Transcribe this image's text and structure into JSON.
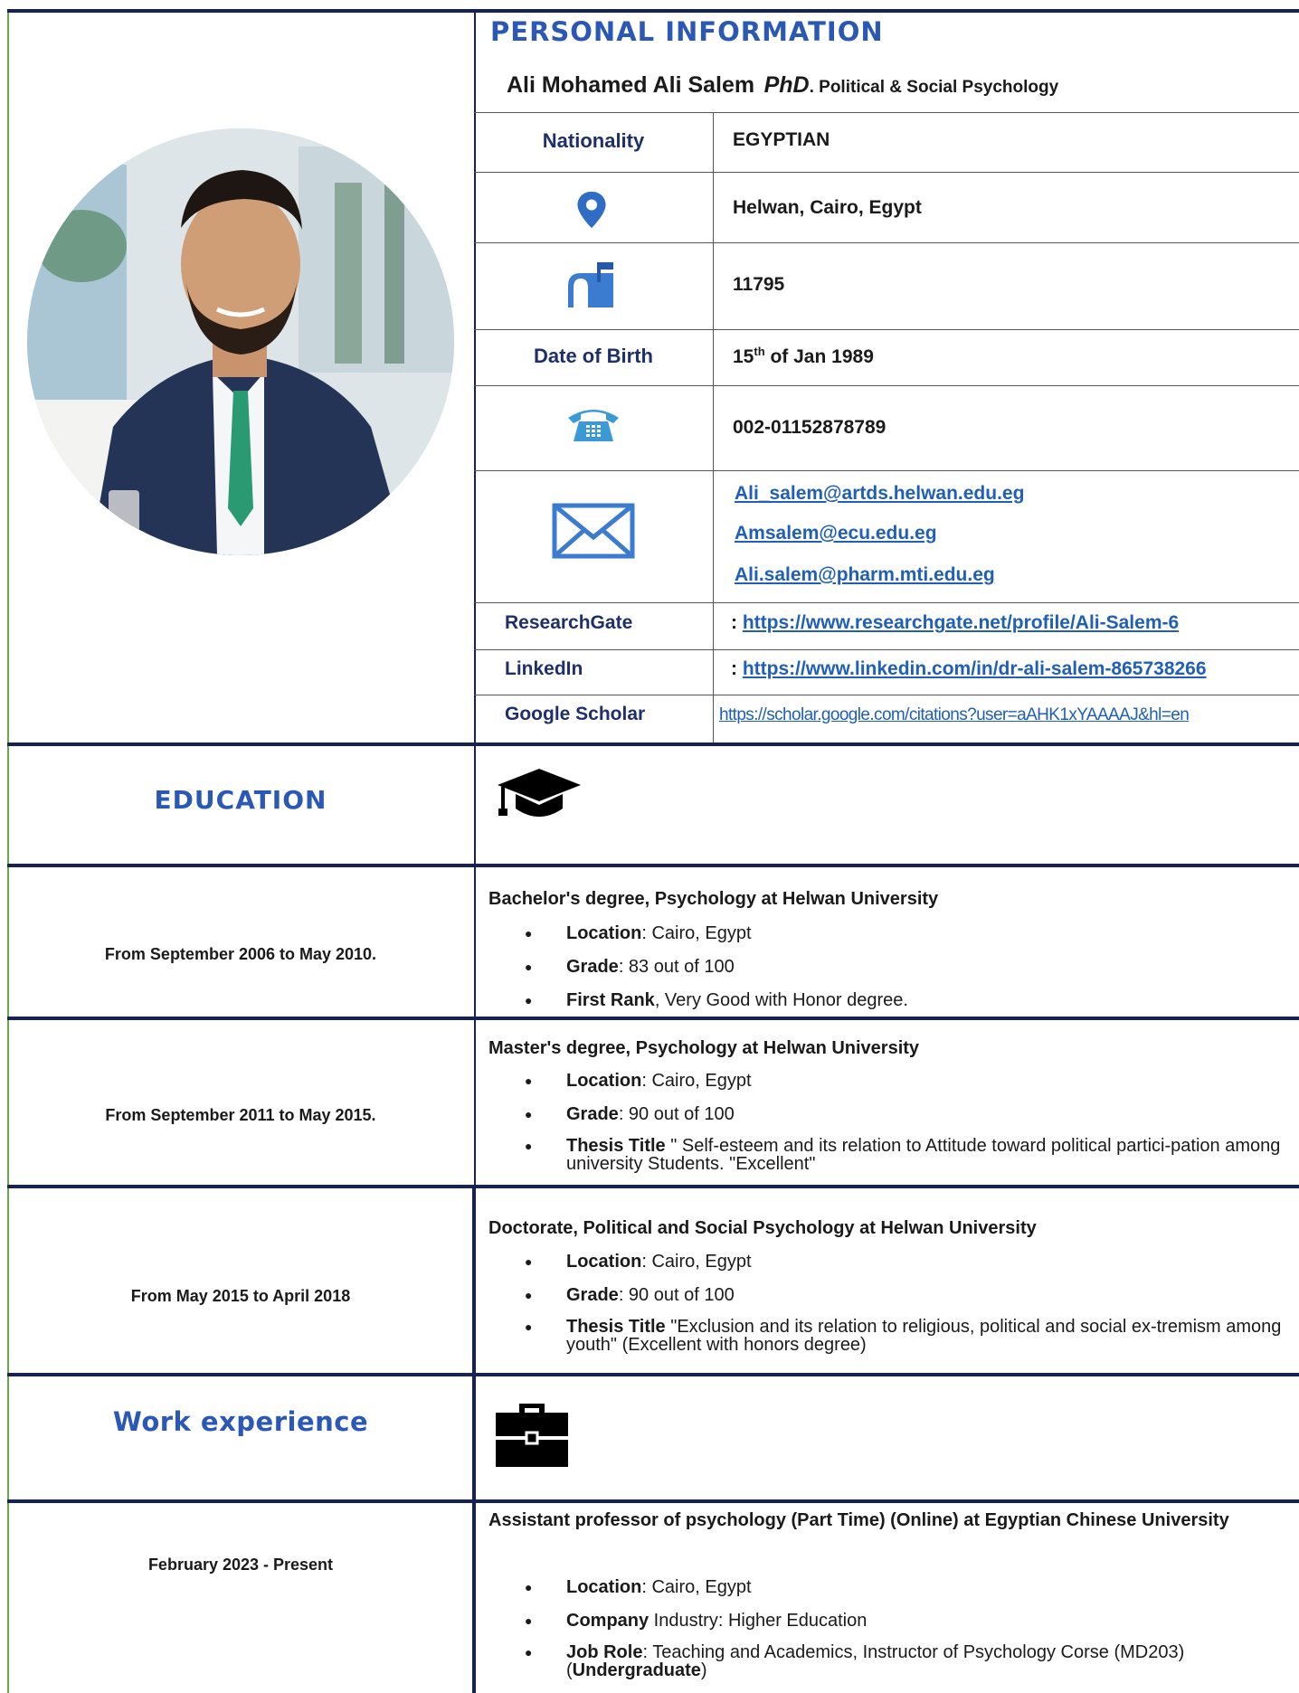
{
  "personal": {
    "section_title": "PERSONAL INFORMATION",
    "name": "Ali Mohamed Ali Salem",
    "degree": "PhD",
    "field": ". Political & Social Psychology",
    "nationality_label": "Nationality",
    "nationality": "EGYPTIAN",
    "address": "Helwan, Cairo, Egypt",
    "postal_code": "11795",
    "dob_label": "Date of Birth",
    "dob_day": "15",
    "dob_sup": "th",
    "dob_rest": " of Jan 1989",
    "phone": "002-01152878789",
    "emails": [
      "Ali_salem@artds.helwan.edu.eg",
      "Amsalem@ecu.edu.eg",
      "Ali.salem@pharm.mti.edu.eg"
    ],
    "researchgate_label": "ResearchGate",
    "researchgate_prefix": ": ",
    "researchgate_url": "https://www.researchgate.net/profile/Ali-Salem-6",
    "linkedin_label": "LinkedIn",
    "linkedin_prefix": ": ",
    "linkedin_url": "https://www.linkedin.com/in/dr-ali-salem-865738266",
    "scholar_label": "Google Scholar",
    "scholar_url": "https://scholar.google.com/citations?user=aAHK1xYAAAAJ&hl=en"
  },
  "icons": {
    "location": "map-pin-icon",
    "mailbox": "mailbox-icon",
    "phone": "telephone-icon",
    "email": "envelope-icon",
    "education": "graduation-cap-icon",
    "work": "briefcase-icon"
  },
  "colors": {
    "accent": "#2b58b4",
    "navy": "#17234e",
    "link": "#1f5fb8",
    "icon": "#3b7bd0"
  },
  "education": {
    "section_title": "EDUCATION",
    "entries": [
      {
        "date": "From September 2006 to May 2010.",
        "title": "Bachelor's degree, Psychology at Helwan University",
        "bullets": [
          {
            "bold": "Location",
            "text": ": Cairo, Egypt"
          },
          {
            "bold": "Grade",
            "text": ": 83 out of 100"
          },
          {
            "bold": "First Rank",
            "text": ", Very Good with Honor degree."
          }
        ]
      },
      {
        "date": "From September 2011 to May 2015.",
        "title": "Master's degree, Psychology at Helwan University",
        "bullets": [
          {
            "bold": "Location",
            "text": ": Cairo, Egypt"
          },
          {
            "bold": "Grade",
            "text": ": 90 out of 100"
          },
          {
            "bold": "Thesis Title",
            "text": " \" Self-esteem and its relation to Attitude toward political partici-pation among university Students. \"Excellent\""
          }
        ]
      },
      {
        "date": "From May 2015 to April 2018",
        "title": "Doctorate, Political and Social Psychology at Helwan University",
        "bullets": [
          {
            "bold": "Location",
            "text": ": Cairo, Egypt"
          },
          {
            "bold": "Grade",
            "text": ": 90 out of 100"
          },
          {
            "bold": "Thesis Title",
            "text": " \"Exclusion and its relation to religious, political and social ex-tremism among youth\" (Excellent with honors degree)"
          }
        ]
      }
    ]
  },
  "work": {
    "section_title": "Work experience",
    "entries": [
      {
        "date": "February 2023 - Present",
        "title": "Assistant professor of psychology (Part Time) (Online) at Egyptian Chinese University",
        "bullets": [
          {
            "bold": "Location",
            "text": ": Cairo, Egypt"
          },
          {
            "bold": "Company",
            "text": " Industry: Higher Education"
          },
          {
            "bold": "Job Role",
            "text": ": Teaching and Academics, Instructor of Psychology Corse (MD203) (",
            "bold2": "Undergraduate",
            "text2": ")"
          }
        ]
      }
    ]
  }
}
